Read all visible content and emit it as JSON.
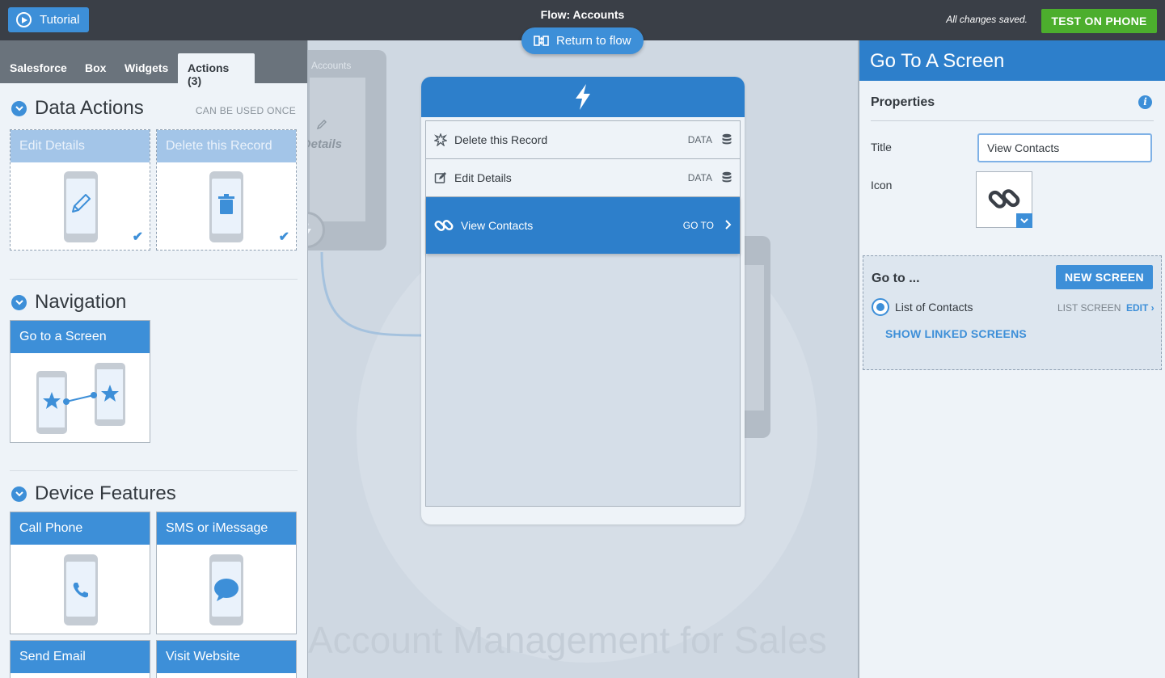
{
  "topbar": {
    "tutorial_label": "Tutorial",
    "flow_title": "Flow: Accounts",
    "saved_status": "All changes saved.",
    "test_label": "TEST ON PHONE",
    "return_label": "Return to flow"
  },
  "left": {
    "tabs": [
      "Salesforce",
      "Box",
      "Widgets",
      "Actions (3)"
    ],
    "active_tab": "Actions (3)",
    "data_actions": {
      "title": "Data Actions",
      "note": "CAN BE USED ONCE",
      "cards": [
        "Edit Details",
        "Delete this Record"
      ]
    },
    "navigation": {
      "title": "Navigation",
      "cards": [
        "Go to a Screen"
      ]
    },
    "device": {
      "title": "Device Features",
      "cards": [
        "Call Phone",
        "SMS or iMessage",
        "Send Email",
        "Visit Website"
      ]
    }
  },
  "canvas": {
    "ghost_label": "Accounts",
    "ghost_text": "Details",
    "watermark": "Account Management for Sales",
    "actions": [
      {
        "label": "Delete this Record",
        "type": "DATA",
        "icon": "burst-icon"
      },
      {
        "label": "Edit Details",
        "type": "DATA",
        "icon": "edit-icon"
      },
      {
        "label": "View Contacts",
        "type": "GO TO",
        "icon": "link-icon"
      }
    ]
  },
  "right": {
    "header": "Go To A Screen",
    "properties_title": "Properties",
    "title_label": "Title",
    "title_value": "View Contacts",
    "icon_label": "Icon",
    "goto_label": "Go to ...",
    "new_screen_label": "NEW SCREEN",
    "screen_name": "List of Contacts",
    "screen_type": "LIST SCREEN",
    "edit_label": "EDIT ›",
    "show_linked_label": "SHOW LINKED SCREENS"
  },
  "colors": {
    "accent": "#3d8fd8",
    "header_blue": "#2d7fcb",
    "topbar": "#3a3f47",
    "test_green": "#4cae2d"
  }
}
